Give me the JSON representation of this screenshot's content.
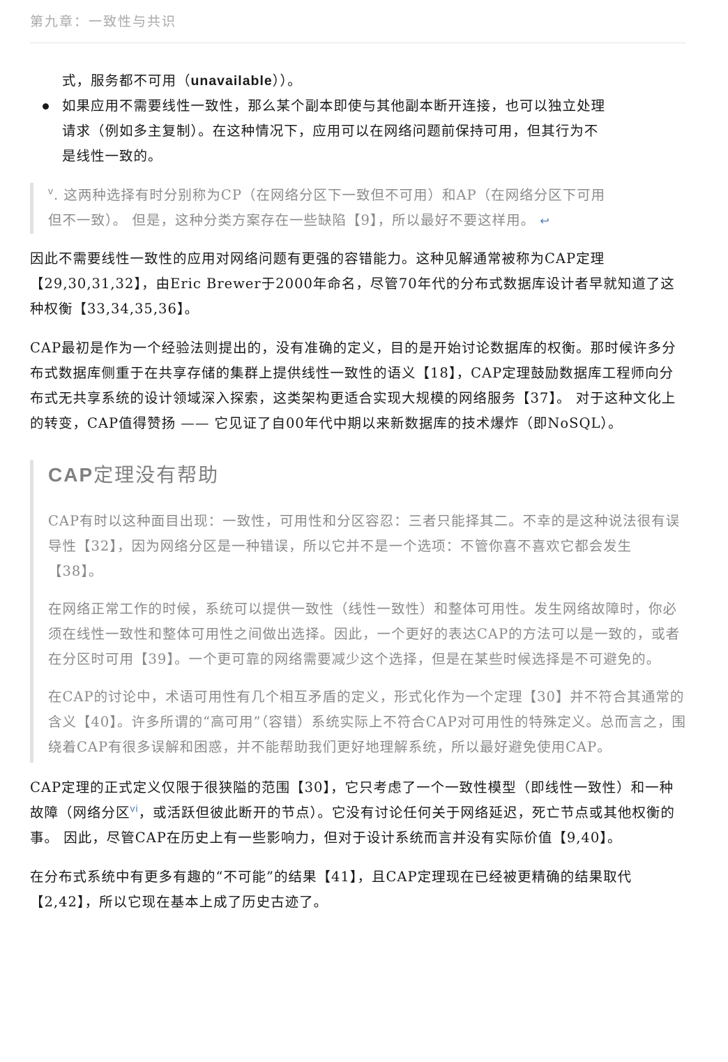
{
  "header": {
    "chapter_title": "第九章：一致性与共识"
  },
  "bullets": {
    "prev_tail_a": "式，服务都不可用（",
    "prev_tail_b": "unavailable",
    "prev_tail_c": "））。",
    "item2_line1": "如果应用不需要线性一致性，那么某个副本即使与其他副本断开连接，也可以独立处理",
    "item2_line2": "请求（例如多主复制）。在这种情况下，应用可以在网络问题前保持可用，但其行为不",
    "item2_line3": "是线性一致的。"
  },
  "footnote": {
    "marker": "v",
    "line1": ". 这两种选择有时分别称为CP（在网络分区下一致但不可用）和AP（在网络分区下可用",
    "line2": "但不一致）。 但是，这种分类方案存在一些缺陷【9】，所以最好不要这样用。",
    "backlink": "↩"
  },
  "paragraphs": {
    "p1": "因此不需要线性一致性的应用对网络问题有更强的容错能力。这种见解通常被称为CAP定理【29,30,31,32】，由Eric Brewer于2000年命名，尽管70年代的分布式数据库设计者早就知道了这种权衡【33,34,35,36】。",
    "p2": " CAP最初是作为一个经验法则提出的，没有准确的定义，目的是开始讨论数据库的权衡。那时候许多分布式数据库侧重于在共享存储的集群上提供线性一致性的语义【18】，CAP定理鼓励数据库工程师向分布式无共享系统的设计领域深入探索，这类架构更适合实现大规模的网络服务【37】。 对于这种文化上的转变，CAP值得赞扬 —— 它见证了自00年代中期以来新数据库的技术爆炸（即NoSQL）。",
    "p3_a": " CAP定理的正式定义仅限于很狭隘的范围【30】，它只考虑了一个一致性模型（即线性一致性）和一种故障（网络分区",
    "p3_sup": "vi",
    "p3_b": "，或活跃但彼此断开的节点）。它没有讨论任何关于网络延迟，死亡节点或其他权衡的事。 因此，尽管CAP在历史上有一些影响力，但对于设计系统而言并没有实际价值【9,40】。",
    "p4": " 在分布式系统中有更多有趣的“不可能”的结果【41】，且CAP定理现在已经被更精确的结果取代【2,42】，所以它现在基本上成了历史古迹了。"
  },
  "sidebar": {
    "title_latin": "CAP",
    "title_rest": "定理没有帮助",
    "q1": "CAP有时以这种面目出现：一致性，可用性和分区容忍：三者只能择其二。不幸的是这种说法很有误导性【32】，因为网络分区是一种错误，所以它并不是一个选项：不管你喜不喜欢它都会发生【38】。",
    "q2": "在网络正常工作的时候，系统可以提供一致性（线性一致性）和整体可用性。发生网络故障时，你必须在线性一致性和整体可用性之间做出选择。因此，一个更好的表达CAP的方法可以是一致的，或者在分区时可用【39】。一个更可靠的网络需要减少这个选择，但是在某些时候选择是不可避免的。",
    "q3": "在CAP的讨论中，术语可用性有几个相互矛盾的定义，形式化作为一个定理【30】并不符合其通常的含义【40】。许多所谓的“高可用”（容错）系统实际上不符合CAP对可用性的特殊定义。总而言之，围绕着CAP有很多误解和困惑，并不能帮助我们更好地理解系统，所以最好避免使用CAP。"
  }
}
